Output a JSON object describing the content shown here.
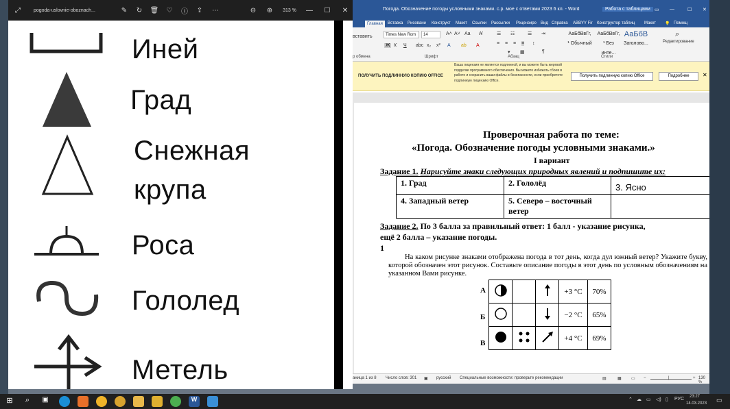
{
  "photos": {
    "title": "pogoda-uslovnie-oboznach...",
    "zoom": "313 %",
    "symbols": [
      {
        "label": "Иней",
        "icon": "hoarfrost-icon"
      },
      {
        "label": "Град",
        "icon": "hail-icon"
      },
      {
        "label": "Снежная",
        "icon": "snow-pellets-icon"
      },
      {
        "label": "крупа",
        "icon": ""
      },
      {
        "label": "Роса",
        "icon": "dew-icon"
      },
      {
        "label": "Гололед",
        "icon": "glaze-ice-icon"
      },
      {
        "label": "Метель",
        "icon": "blizzard-icon"
      }
    ]
  },
  "word": {
    "title": "Погода. Обозначение погоды условными знаками. с.р. мое с ответами 2023 6 кл. - Word",
    "context_tab": "Работа с таблицами",
    "signin": "Помощ",
    "tabs": [
      "Главная",
      "Вставка",
      "Рисовани",
      "Конструкт",
      "Макет",
      "Ссылки",
      "Рассылки",
      "Рецензиро",
      "Вид",
      "Справка",
      "ABBYY Fir",
      "Конструктор таблиц",
      "Макет"
    ],
    "ribbon": {
      "paste": "вставить",
      "clipboard": "р обмена",
      "font_name": "Times New Rom",
      "font_size": "14",
      "font_group": "Шрифт",
      "paragraph_group": "Абзац",
      "styles_group": "Стили",
      "styles": [
        {
          "sample": "АаБбВвГг,",
          "name": "¹ Обычный"
        },
        {
          "sample": "АаБбВвГг,",
          "name": "¹ Без инте..."
        },
        {
          "sample": "АаБбВ",
          "name": "Заголово..."
        }
      ],
      "editing": "Редактирование"
    },
    "license": {
      "bold": "ПОЛУЧИТЬ ПОДЛИННУЮ КОПИЮ OFFICE",
      "text": "Ваша лицензия не является подлинной, и вы можете быть жертвой подделки программного обеспечения. Вы можете избежать сбоев в работе и сохранить ваши файлы в безопасности, если приобретете подлинную лицензию Office.",
      "btn_get": "Получить подлинную копию Office",
      "btn_more": "Подробнее"
    },
    "doc": {
      "heading1": "Проверочная работа по теме:",
      "heading2": "«Погода. Обозначение погоды условными знаками.»",
      "variant": "I вариант",
      "task1_label": "Задание 1.",
      "task1_text": "Нарисуйте знаки следующих природных явлений и подпишите их:",
      "table1": [
        [
          "1.  Град",
          "2.  Гололёд",
          "3.  Ясно"
        ],
        [
          "4.  Западный ветер",
          "5.  Северо – восточный ветер",
          ""
        ]
      ],
      "task2_label": "Задание 2.",
      "task2_text": "По 3 балла за правильный ответ: 1 балл - указание рисунка,",
      "task2_text2": "ещё 2 балла – указание погоды.",
      "num": "1",
      "question": "На каком рисунке знаками отображена погода в тот день, когда дул южный ветер? Укажите букву, которой обозначен этот рисунок. Составьте описание погоды в этот день по условным обозначениям на указанном Вами рисунке.",
      "rows": [
        {
          "letter": "А",
          "temp": "+3 °C",
          "humid": "70%"
        },
        {
          "letter": "Б",
          "temp": "−2 °C",
          "humid": "65%"
        },
        {
          "letter": "В",
          "temp": "+4 °C",
          "humid": "69%"
        }
      ]
    },
    "status": {
      "page": "аница 1 из 8",
      "words": "Число слов: 301",
      "lang": "русский",
      "access": "Специальные возможности: проверьте рекомендации",
      "zoom": "130 %"
    }
  },
  "taskbar": {
    "lang": "РУС",
    "time": "23:27",
    "date": "14.03.2023"
  }
}
